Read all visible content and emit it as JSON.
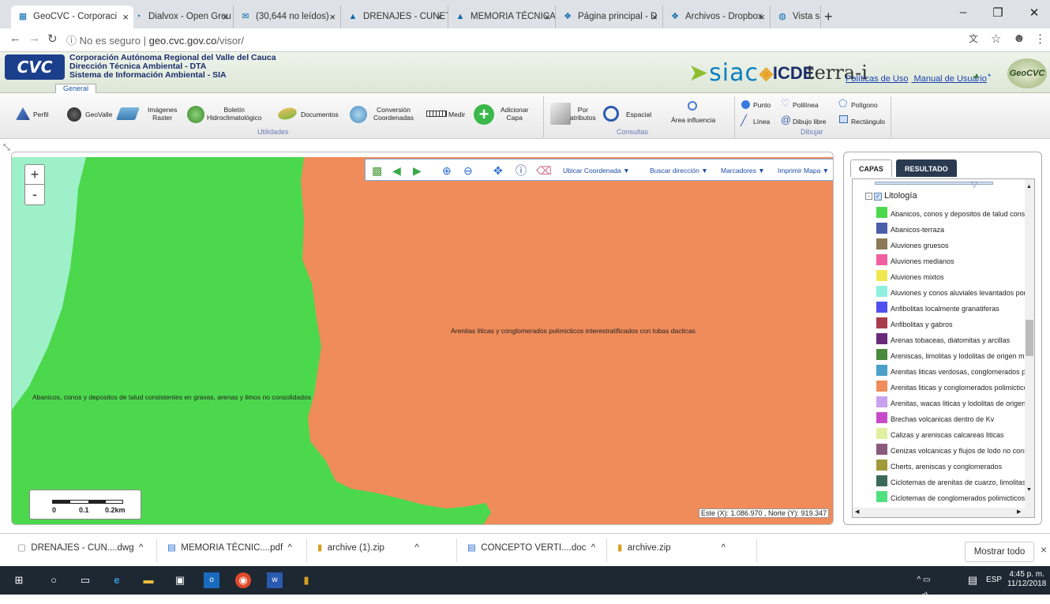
{
  "browser": {
    "tabs": [
      {
        "title": "GeoCVC - Corporaci",
        "active": true
      },
      {
        "title": "Dialvox - Open Grou"
      },
      {
        "title": "(30,644 no leídos) -"
      },
      {
        "title": "DRENAJES - CUNET"
      },
      {
        "title": "MEMORIA TÉCNICA"
      },
      {
        "title": "Página principal - D"
      },
      {
        "title": "Archivos - Dropbox"
      },
      {
        "title": "Vista satélital de Bu"
      }
    ],
    "security": "No es seguro",
    "url_host": "geo.cvc.gov.co",
    "url_path": "/visor/"
  },
  "header": {
    "logo": "CVC",
    "org_line1": "Corporación Autónoma Regional del Valle del Cauca",
    "org_line2": "Dirección Técnica Ambiental - DTA",
    "org_line3": "Sistema de Información Ambiental - SIA",
    "tab_general": "General",
    "siac": "siac",
    "icde": "ICDE",
    "terra": "terra-i",
    "link_policies": "Políticas de Uso",
    "link_manual": "Manual de Usuario",
    "geocvc": "GeoCVC"
  },
  "toolbar": {
    "perfil": "Perfil",
    "geovalle": "GeoValle",
    "imagenes_1": "Imágenes",
    "imagenes_2": "Raster",
    "boletin_1": "Boletín",
    "boletin_2": "Hidroclimatológico",
    "documentos": "Documentos",
    "conversion_1": "Conversión",
    "conversion_2": "Coordenadas",
    "medir": "Medir",
    "adicionar_1": "Adicionar",
    "adicionar_2": "Capa",
    "group_utilidades": "Utilidades",
    "por_1": "Por",
    "por_2": "atributos",
    "espacial": "Espacial",
    "area": "Área influencia",
    "group_consultas": "Consultas",
    "punto": "Punto",
    "linea": "Línea",
    "polilinea": "Polilínea",
    "dibujo_libre": "Dibujo libre",
    "poligono": "Polígono",
    "rectangulo": "Rectángulo",
    "group_dibujar": "Dibujar"
  },
  "map": {
    "label_left": "Abanicos, conos y depositos de talud consistentes en gravas, arenas y limos no consolidados",
    "label_right": "Arenitas liticas y conglomerados polimicticos interestratificados con tobas dacticas",
    "tool_ubicar": "Ubicar Coordenada",
    "tool_buscar": "Buscar dirección",
    "tool_marcadores": "Marcadores",
    "tool_imprimir": "Imprimir Mapa",
    "scale_0": "0",
    "scale_1": "0.1",
    "scale_2": "0.2km",
    "coordinates": "Este (X): 1.086.970 , Norte (Y): 919.347",
    "colors": {
      "green": "#4cd84c",
      "orange": "#ef8c5a",
      "mint": "#9ef0c8"
    }
  },
  "panel": {
    "tab_capas": "CAPAS",
    "tab_resultado": "RESULTADO",
    "layer_title": "Litología",
    "legend": [
      {
        "label": "Abanicos, conos y depositos de talud consist",
        "color": "#4cd84c"
      },
      {
        "label": "Abanicos-terraza",
        "color": "#4b5ea8"
      },
      {
        "label": "Aluviones gruesos",
        "color": "#8a7a55"
      },
      {
        "label": "Aluviones medianos",
        "color": "#f060a0"
      },
      {
        "label": "Aluviones mixtos",
        "color": "#f0e850"
      },
      {
        "label": "Aluviones y conos aluviales levantados por e",
        "color": "#90f0e0"
      },
      {
        "label": "Anfibolitas localmente granatiferas",
        "color": "#5050f0"
      },
      {
        "label": "Anfibolitas y gabros",
        "color": "#a83c4c"
      },
      {
        "label": "Arenas tobaceas, diatomitas y arcillas",
        "color": "#6a2a7a"
      },
      {
        "label": "Areniscas, limolitas y lodolitas de origen ma",
        "color": "#4a8a3c"
      },
      {
        "label": "Arenitas liticas verdosas, conglomerados pol",
        "color": "#4aa0c8"
      },
      {
        "label": "Arenitas liticas y conglomerados polimicticos",
        "color": "#ef8c5a"
      },
      {
        "label": "Arenitas, wacas liticas y lodolitas de origen",
        "color": "#c8a0f0"
      },
      {
        "label": "Brechas volcanicas dentro de Kv",
        "color": "#c84ac8"
      },
      {
        "label": "Calizas y areniscas calcareas liticas",
        "color": "#e0f0a0"
      },
      {
        "label": "Cenizas volcanicas y flujos de lodo no conso",
        "color": "#8a5a7a"
      },
      {
        "label": "Cherts, areniscas y conglomerados",
        "color": "#a09a3a"
      },
      {
        "label": "Ciclotemas de arenitas de cuarzo, limolitas,",
        "color": "#3a6a5a"
      },
      {
        "label": "Ciclotemas de conglomerados polimicticos a",
        "color": "#50e080"
      }
    ]
  },
  "downloads": {
    "items": [
      "DRENAJES - CUN....dwg",
      "MEMORIA TÉCNIC....pdf",
      "archive (1).zip",
      "CONCEPTO VERTI....doc",
      "archive.zip"
    ],
    "show_all": "Mostrar todo"
  },
  "taskbar": {
    "lang": "ESP",
    "time": "4:45 p. m.",
    "date": "11/12/2018"
  }
}
